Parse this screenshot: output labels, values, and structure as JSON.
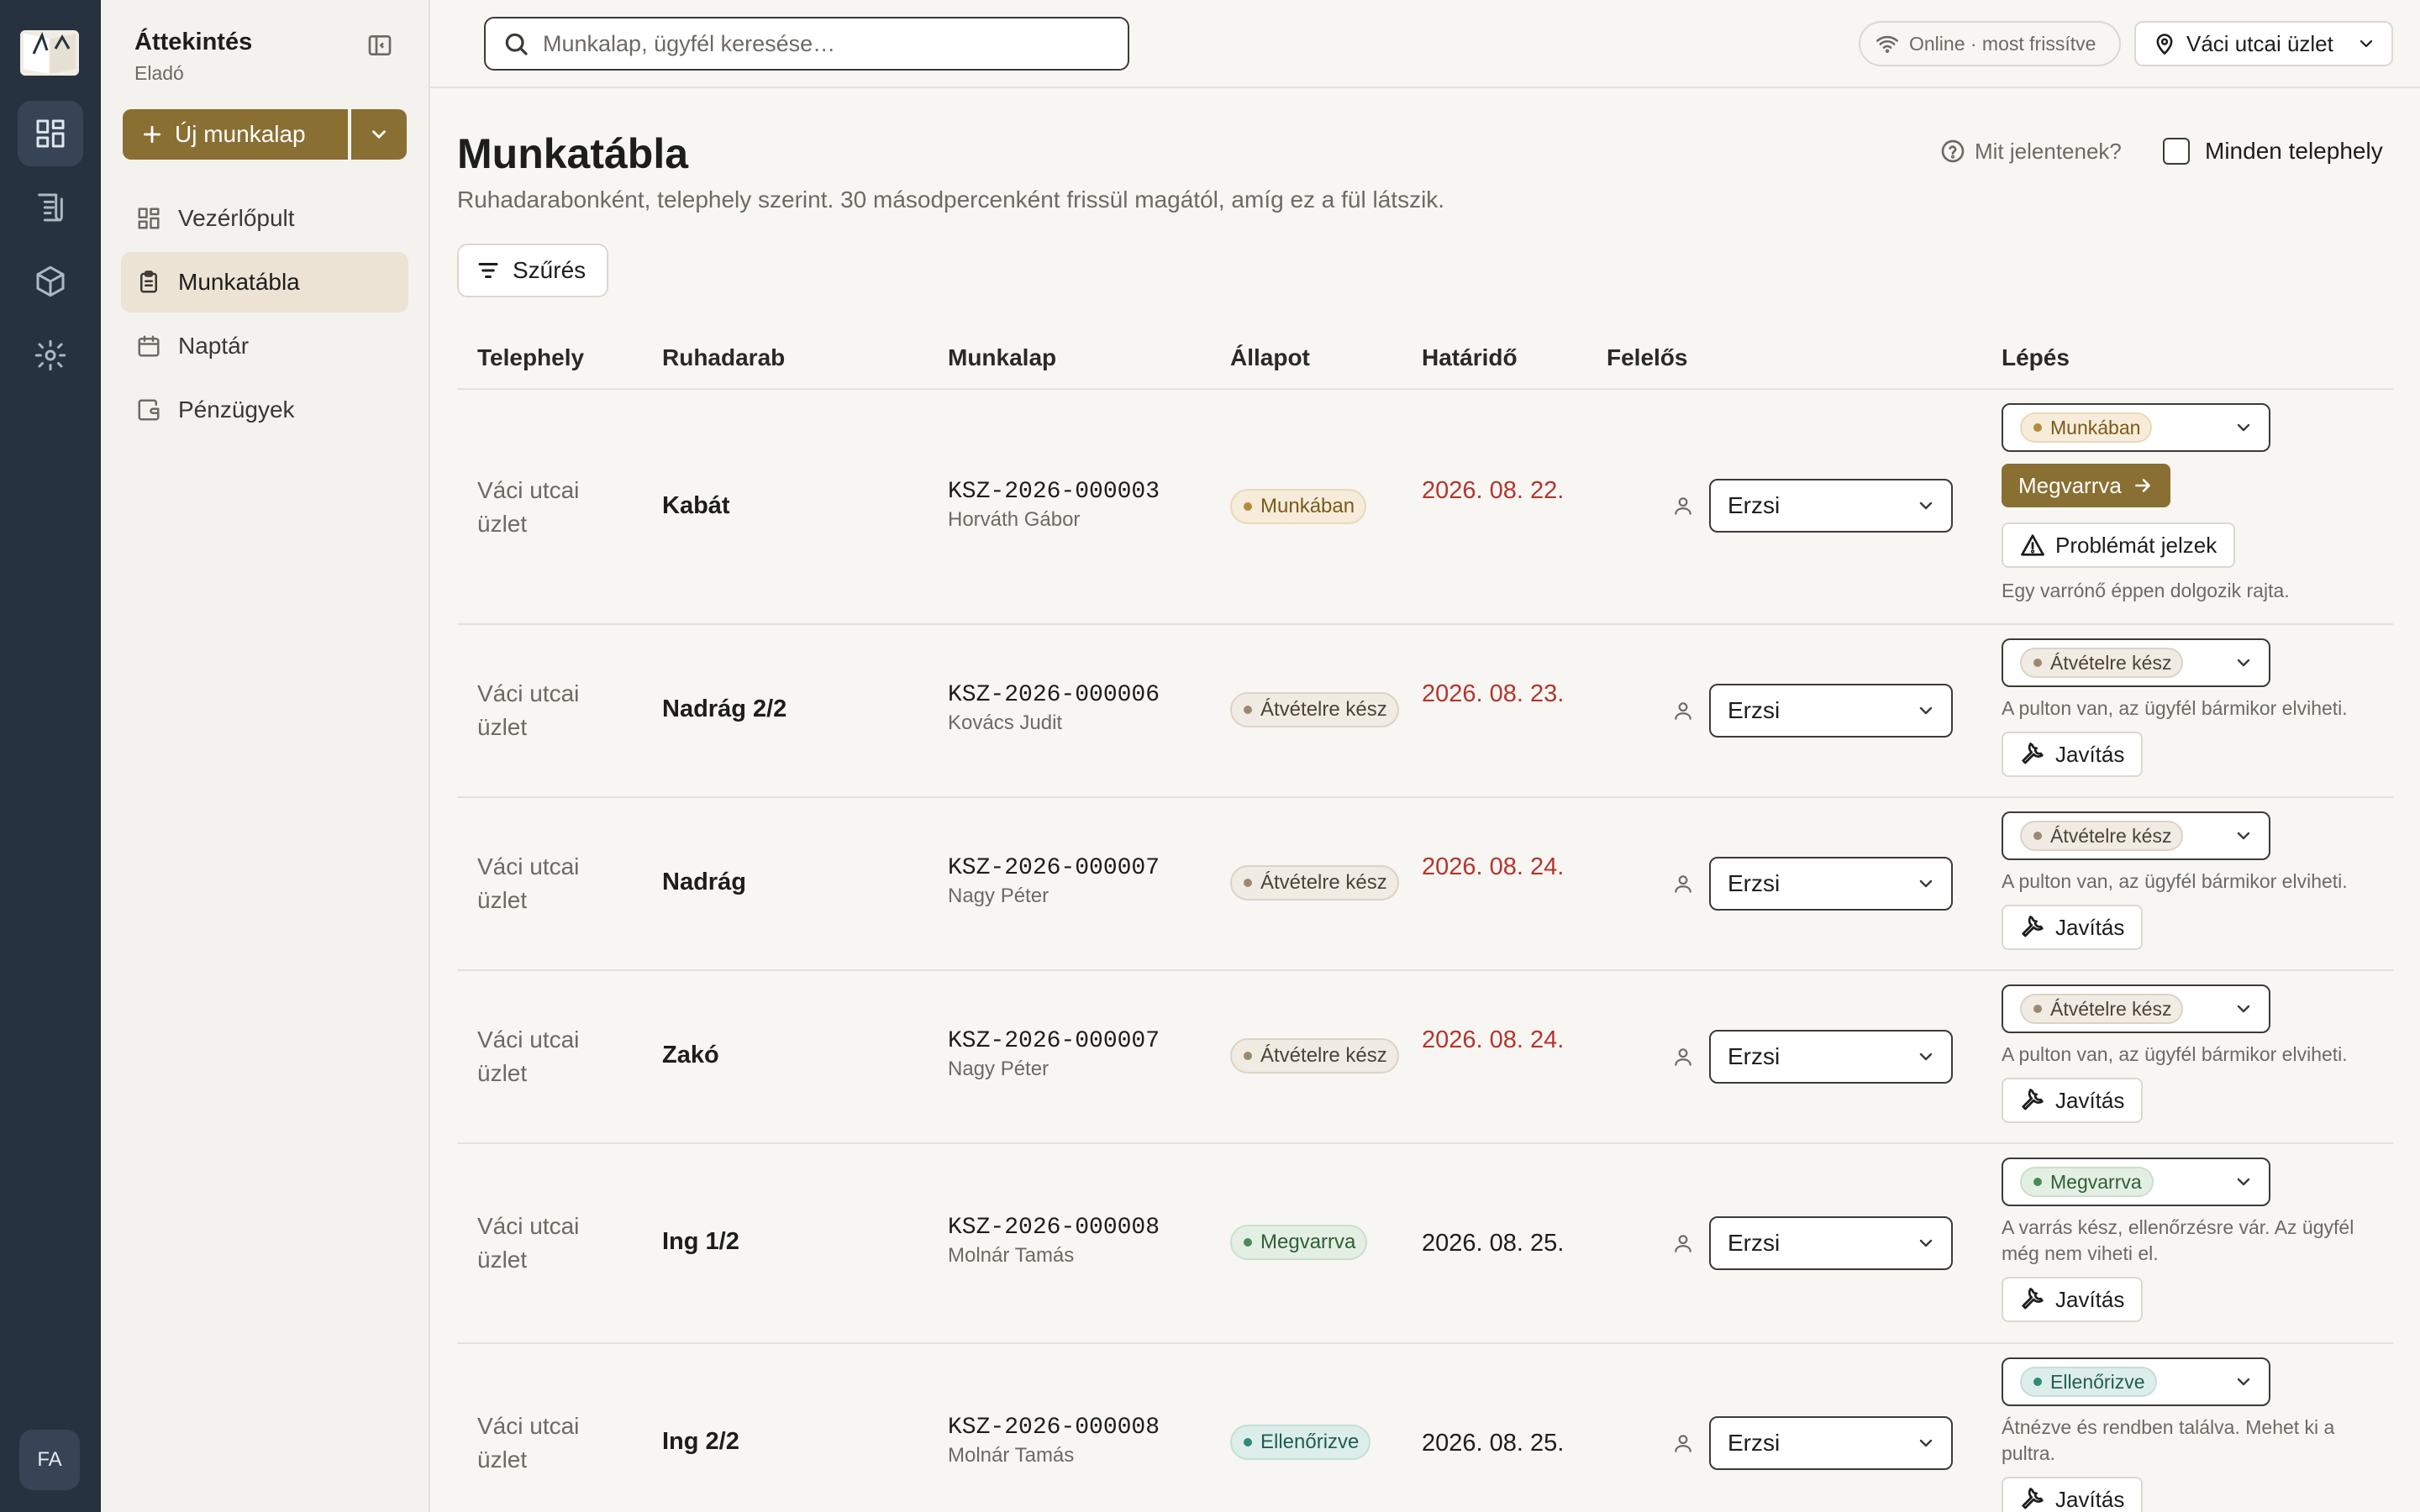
{
  "app": {
    "avatar_initials": "FA"
  },
  "sidebar": {
    "title": "Áttekintés",
    "subtitle": "Eladó",
    "new_button": "Új munkalap",
    "items": [
      {
        "label": "Vezérlőpult",
        "icon": "dashboard-icon"
      },
      {
        "label": "Munkatábla",
        "icon": "clipboard-icon",
        "active": true
      },
      {
        "label": "Naptár",
        "icon": "calendar-icon"
      },
      {
        "label": "Pénzügyek",
        "icon": "wallet-icon"
      }
    ]
  },
  "topbar": {
    "search_placeholder": "Munkalap, ügyfél keresése…",
    "status": "Online · most frissítve",
    "store": "Váci utcai üzlet"
  },
  "page": {
    "title": "Munkatábla",
    "subtitle": "Ruhadarabonként, telephely szerint. 30 másodpercenként frissül magától, amíg ez a fül látszik.",
    "help": "Mit jelentenek?",
    "all_sites": "Minden telephely",
    "filter": "Szűrés"
  },
  "table": {
    "headers": [
      "Telephely",
      "Ruhadarab",
      "Munkalap",
      "Állapot",
      "Határidő",
      "Felelős",
      "Lépés"
    ],
    "rows": [
      {
        "location": "Váci utcai üzlet",
        "item": "Kabát",
        "code": "KSZ-2026-000003",
        "customer": "Horváth Gábor",
        "status": "Munkában",
        "due": "2026. 08. 22.",
        "owner": "Erzsi",
        "step_status": "Munkában",
        "advance": "Megvarrva",
        "action": "Problémát jelzek",
        "hint": "Egy varrónő éppen dolgozik rajta."
      },
      {
        "location": "Váci utcai üzlet",
        "item": "Nadrág 2/2",
        "code": "KSZ-2026-000006",
        "customer": "Kovács Judit",
        "status": "Átvételre kész",
        "due": "2026. 08. 23.",
        "owner": "Erzsi",
        "step_status": "Átvételre kész",
        "hint": "A pulton van, az ügyfél bármikor elviheti.",
        "action": "Javítás"
      },
      {
        "location": "Váci utcai üzlet",
        "item": "Nadrág",
        "code": "KSZ-2026-000007",
        "customer": "Nagy Péter",
        "status": "Átvételre kész",
        "due": "2026. 08. 24.",
        "owner": "Erzsi",
        "step_status": "Átvételre kész",
        "hint": "A pulton van, az ügyfél bármikor elviheti.",
        "action": "Javítás"
      },
      {
        "location": "Váci utcai üzlet",
        "item": "Zakó",
        "code": "KSZ-2026-000007",
        "customer": "Nagy Péter",
        "status": "Átvételre kész",
        "due": "2026. 08. 24.",
        "owner": "Erzsi",
        "step_status": "Átvételre kész",
        "hint": "A pulton van, az ügyfél bármikor elviheti.",
        "action": "Javítás"
      },
      {
        "location": "Váci utcai üzlet",
        "item": "Ing 1/2",
        "code": "KSZ-2026-000008",
        "customer": "Molnár Tamás",
        "status": "Megvarrva",
        "due": "2026. 08. 25.",
        "owner": "Erzsi",
        "step_status": "Megvarrva",
        "hint": "A varrás kész, ellenőrzésre vár. Az ügyfél még nem viheti el.",
        "action": "Javítás"
      },
      {
        "location": "Váci utcai üzlet",
        "item": "Ing 2/2",
        "code": "KSZ-2026-000008",
        "customer": "Molnár Tamás",
        "status": "Ellenőrizve",
        "due": "2026. 08. 25.",
        "owner": "Erzsi",
        "step_status": "Ellenőrizve",
        "hint": "Átnézve és rendben találva. Mehet ki a pultra.",
        "action": "Javítás"
      }
    ]
  },
  "colors": {
    "accent": "#8a6f33",
    "rail": "#26323f",
    "late": "#b3362e"
  }
}
